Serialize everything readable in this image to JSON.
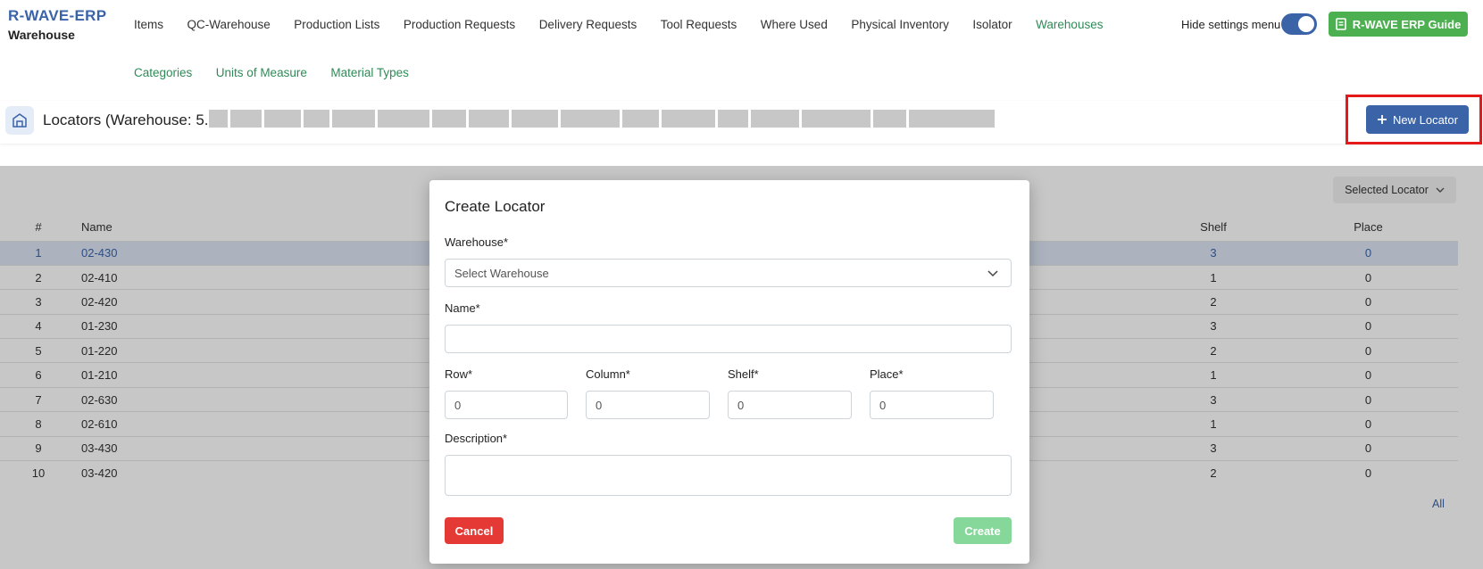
{
  "brand": {
    "title": "R-WAVE-ERP",
    "subtitle": "Warehouse"
  },
  "nav": {
    "row1": [
      "Items",
      "QC-Warehouse",
      "Production Lists",
      "Production Requests",
      "Delivery Requests",
      "Tool Requests",
      "Where Used",
      "Physical Inventory",
      "Isolator",
      "Warehouses"
    ],
    "row2": [
      "Categories",
      "Units of Measure",
      "Material Types"
    ],
    "active": "Warehouses"
  },
  "settings": {
    "hide_label": "Hide settings menu",
    "hide_enabled": true
  },
  "guide_button": "R-WAVE ERP Guide",
  "page": {
    "title": "Locators (Warehouse: 5.",
    "new_button": "New Locator"
  },
  "table": {
    "selector": "Selected Locator",
    "headers": {
      "num": "#",
      "name": "Name",
      "shelf": "Shelf",
      "place": "Place"
    },
    "rows": [
      {
        "num": "1",
        "name": "02-430",
        "shelf": "3",
        "place": "0"
      },
      {
        "num": "2",
        "name": "02-410",
        "shelf": "1",
        "place": "0"
      },
      {
        "num": "3",
        "name": "02-420",
        "shelf": "2",
        "place": "0"
      },
      {
        "num": "4",
        "name": "01-230",
        "shelf": "3",
        "place": "0"
      },
      {
        "num": "5",
        "name": "01-220",
        "shelf": "2",
        "place": "0"
      },
      {
        "num": "6",
        "name": "01-210",
        "shelf": "1",
        "place": "0"
      },
      {
        "num": "7",
        "name": "02-630",
        "shelf": "3",
        "place": "0"
      },
      {
        "num": "8",
        "name": "02-610",
        "shelf": "1",
        "place": "0"
      },
      {
        "num": "9",
        "name": "03-430",
        "shelf": "3",
        "place": "0"
      },
      {
        "num": "10",
        "name": "03-420",
        "shelf": "2",
        "place": "0"
      }
    ],
    "pager_all": "All"
  },
  "modal": {
    "title": "Create Locator",
    "warehouse_label": "Warehouse*",
    "warehouse_placeholder": "Select Warehouse",
    "name_label": "Name*",
    "name_value": "",
    "row_label": "Row*",
    "row_value": "0",
    "column_label": "Column*",
    "column_value": "0",
    "shelf_label": "Shelf*",
    "shelf_value": "0",
    "place_label": "Place*",
    "place_value": "0",
    "description_label": "Description*",
    "cancel": "Cancel",
    "create": "Create"
  },
  "colors": {
    "primary": "#3a63a8",
    "success": "#4caf50",
    "danger": "#e53935",
    "highlight": "#e41a1a"
  }
}
